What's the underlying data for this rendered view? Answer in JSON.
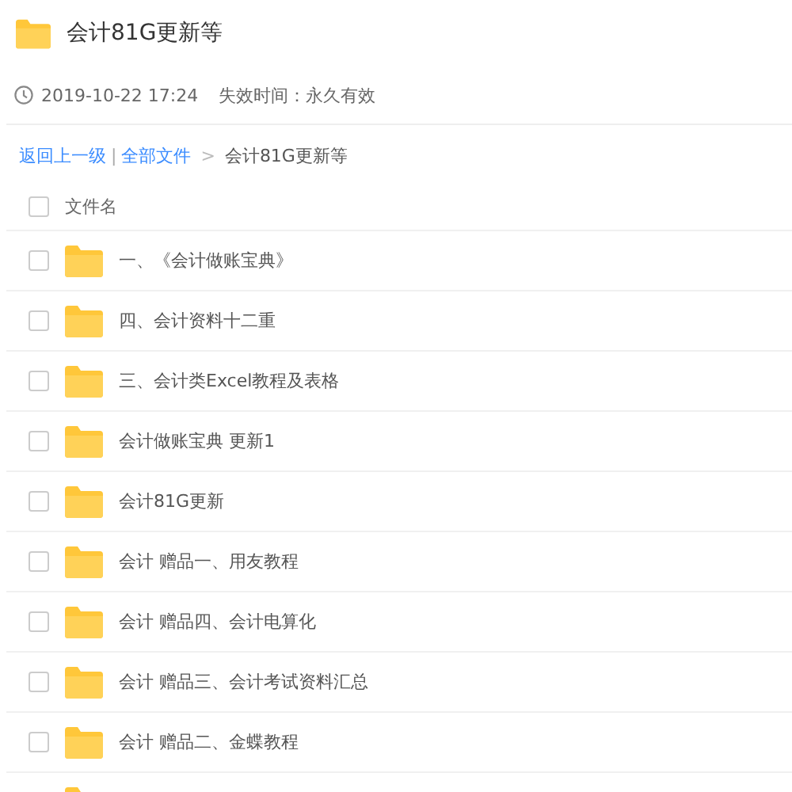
{
  "title": "会计81G更新等",
  "meta": {
    "date": "2019-10-22 17:24",
    "expiry": "失效时间：永久有效"
  },
  "breadcrumb": {
    "back": "返回上一级",
    "separator": "|",
    "root": "全部文件",
    "arrow": ">",
    "current": "会计81G更新等"
  },
  "header": {
    "label": "文件名",
    "checked": false
  },
  "files": [
    {
      "name": "一、《会计做账宝典》",
      "checked": false
    },
    {
      "name": "四、会计资料十二重",
      "checked": false
    },
    {
      "name": "三、会计类Excel教程及表格",
      "checked": false
    },
    {
      "name": "会计做账宝典 更新1",
      "checked": false
    },
    {
      "name": "会计81G更新",
      "checked": false
    },
    {
      "name": "会计 赠品一、用友教程",
      "checked": false
    },
    {
      "name": "会计 赠品四、会计电算化",
      "checked": false
    },
    {
      "name": "会计 赠品三、会计考试资料汇总",
      "checked": false
    },
    {
      "name": "会计 赠品二、金蝶教程",
      "checked": false
    }
  ]
}
